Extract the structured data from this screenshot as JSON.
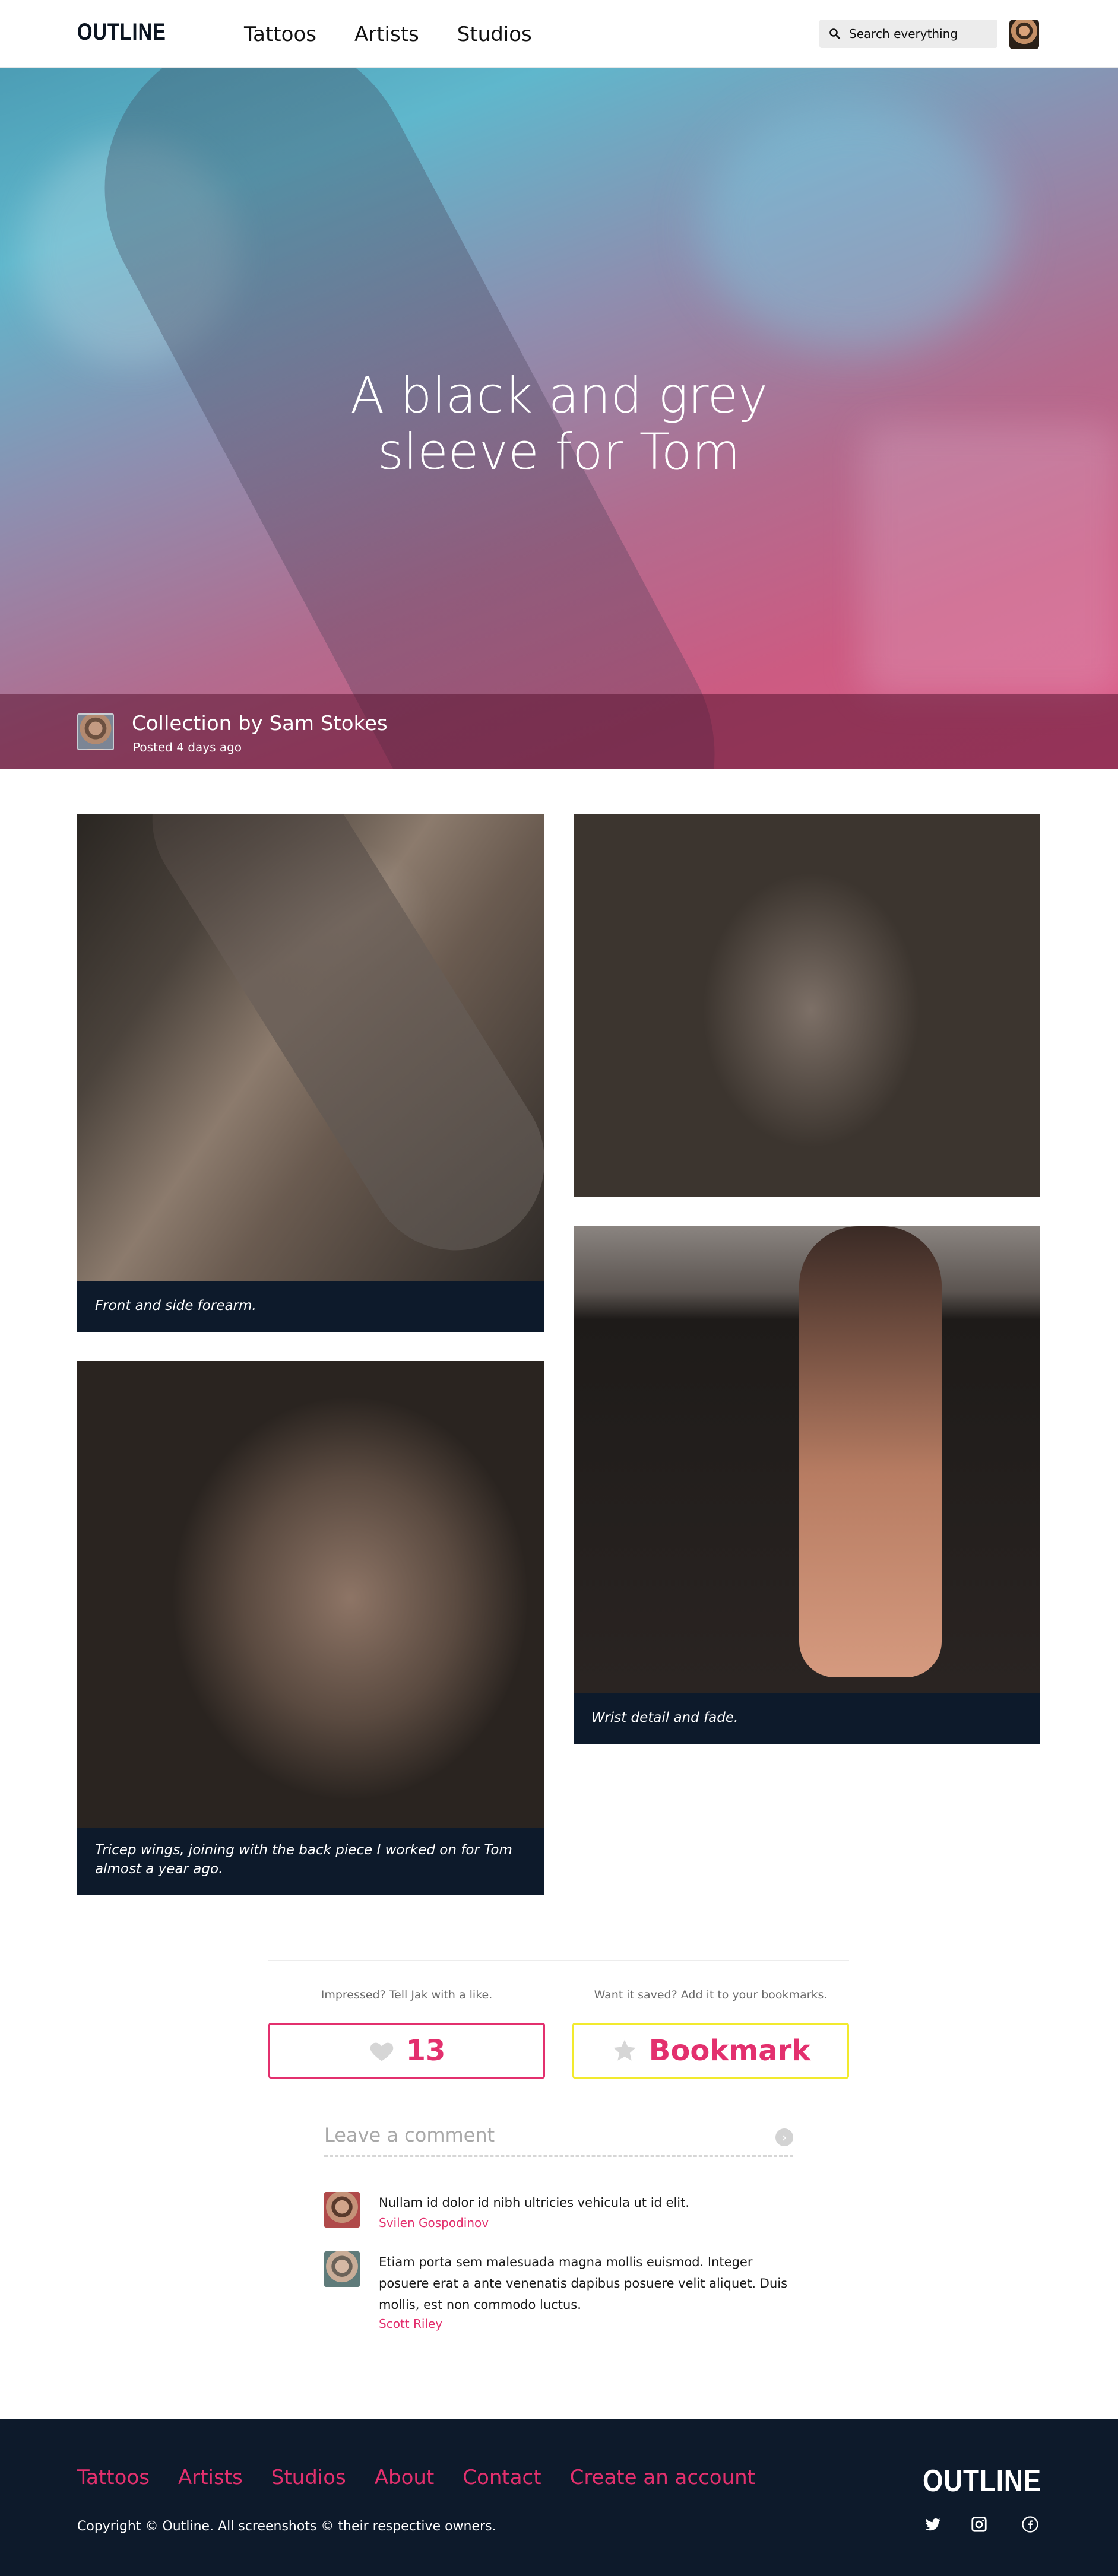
{
  "header": {
    "logo": "OUTLINE",
    "nav": [
      "Tattoos",
      "Artists",
      "Studios"
    ],
    "search_placeholder": "Search everything"
  },
  "hero": {
    "title_line1": "A black and grey",
    "title_line2": "sleeve for Tom",
    "author": "Collection by Sam Stokes",
    "posted": "Posted 4 days ago"
  },
  "gallery": {
    "captions": {
      "forearm": "Front and side forearm.",
      "wrist": "Wrist detail and fade.",
      "tricep_line1": "Tricep wings, joining with the back piece I worked on for Tom",
      "tricep_line2": "almost a year ago."
    }
  },
  "actions": {
    "like_hint": "Impressed? Tell Jak with a like.",
    "like_count": "13",
    "bookmark_hint": "Want it saved? Add it to your bookmarks.",
    "bookmark_label": "Bookmark"
  },
  "comments": {
    "placeholder": "Leave a comment",
    "items": [
      {
        "text": "Nullam id dolor id nibh ultricies vehicula ut id elit.",
        "author": "Svilen Gospodinov"
      },
      {
        "text_line1": "Etiam porta sem malesuada magna mollis euismod. Integer",
        "text_line2": "posuere erat a ante venenatis dapibus posuere velit aliquet. Duis",
        "text_line3": "mollis, est non commodo luctus.",
        "author": "Scott Riley"
      }
    ]
  },
  "footer": {
    "links": [
      "Tattoos",
      "Artists",
      "Studios",
      "About",
      "Contact",
      "Create an account"
    ],
    "copyright": "Copyright © Outline. All screenshots © their respective owners.",
    "logo": "OUTLINE",
    "social_icons": [
      "twitter-icon",
      "instagram-icon",
      "facebook-icon"
    ]
  },
  "colors": {
    "accent": "#e3306e",
    "bookmark_border": "#f2ea2e",
    "dark": "#0d1a2b"
  }
}
